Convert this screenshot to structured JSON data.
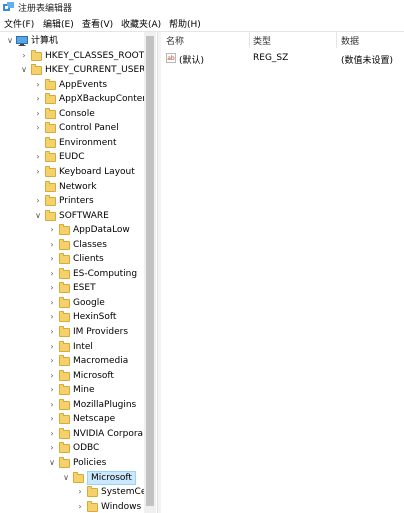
{
  "window": {
    "title": "注册表编辑器"
  },
  "menu": [
    "文件(F)",
    "编辑(E)",
    "查看(V)",
    "收藏夹(A)",
    "帮助(H)"
  ],
  "tree": [
    {
      "label": "计算机",
      "level": 0,
      "expanded": true,
      "icon": "computer-icon"
    },
    {
      "label": "HKEY_CLASSES_ROOT",
      "level": 1,
      "expanded": false
    },
    {
      "label": "HKEY_CURRENT_USER",
      "level": 1,
      "expanded": true
    },
    {
      "label": "AppEvents",
      "level": 2,
      "expanded": false
    },
    {
      "label": "AppXBackupConter",
      "level": 2,
      "expanded": false
    },
    {
      "label": "Console",
      "level": 2,
      "expanded": false
    },
    {
      "label": "Control Panel",
      "level": 2,
      "expanded": false
    },
    {
      "label": "Environment",
      "level": 2,
      "expanded": null
    },
    {
      "label": "EUDC",
      "level": 2,
      "expanded": false
    },
    {
      "label": "Keyboard Layout",
      "level": 2,
      "expanded": false
    },
    {
      "label": "Network",
      "level": 2,
      "expanded": null
    },
    {
      "label": "Printers",
      "level": 2,
      "expanded": false
    },
    {
      "label": "SOFTWARE",
      "level": 2,
      "expanded": true
    },
    {
      "label": "AppDataLow",
      "level": 3,
      "expanded": false
    },
    {
      "label": "Classes",
      "level": 3,
      "expanded": false
    },
    {
      "label": "Clients",
      "level": 3,
      "expanded": false
    },
    {
      "label": "ES-Computing",
      "level": 3,
      "expanded": false
    },
    {
      "label": "ESET",
      "level": 3,
      "expanded": false
    },
    {
      "label": "Google",
      "level": 3,
      "expanded": false
    },
    {
      "label": "HexinSoft",
      "level": 3,
      "expanded": false
    },
    {
      "label": "IM Providers",
      "level": 3,
      "expanded": false
    },
    {
      "label": "Intel",
      "level": 3,
      "expanded": false
    },
    {
      "label": "Macromedia",
      "level": 3,
      "expanded": false
    },
    {
      "label": "Microsoft",
      "level": 3,
      "expanded": false
    },
    {
      "label": "Mine",
      "level": 3,
      "expanded": false
    },
    {
      "label": "MozillaPlugins",
      "level": 3,
      "expanded": false
    },
    {
      "label": "Netscape",
      "level": 3,
      "expanded": false
    },
    {
      "label": "NVIDIA Corpora",
      "level": 3,
      "expanded": false
    },
    {
      "label": "ODBC",
      "level": 3,
      "expanded": false
    },
    {
      "label": "Policies",
      "level": 3,
      "expanded": true
    },
    {
      "label": "Microsoft",
      "level": 4,
      "expanded": true,
      "selected": true
    },
    {
      "label": "SystemCe",
      "level": 5,
      "expanded": false
    },
    {
      "label": "Windows",
      "level": 5,
      "expanded": false
    }
  ],
  "columns": {
    "name": "名称",
    "type": "类型",
    "data": "数据"
  },
  "values": [
    {
      "name": "(默认)",
      "type": "REG_SZ",
      "data": "(数值未设置)",
      "icon": "ab-icon"
    }
  ]
}
